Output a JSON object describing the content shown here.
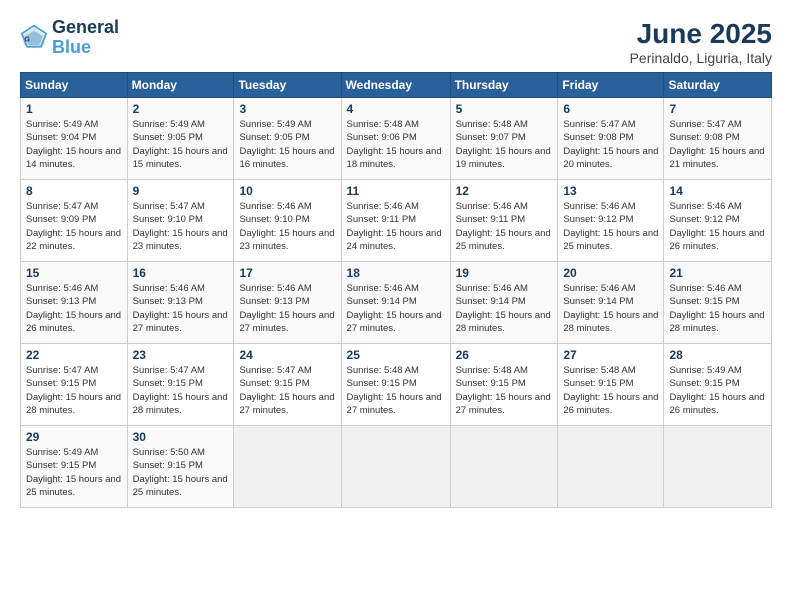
{
  "logo": {
    "line1": "General",
    "line2": "Blue"
  },
  "title": "June 2025",
  "location": "Perinaldo, Liguria, Italy",
  "weekdays": [
    "Sunday",
    "Monday",
    "Tuesday",
    "Wednesday",
    "Thursday",
    "Friday",
    "Saturday"
  ],
  "weeks": [
    [
      {
        "day": 1,
        "sunrise": "5:49 AM",
        "sunset": "9:04 PM",
        "daylight": "15 hours and 14 minutes."
      },
      {
        "day": 2,
        "sunrise": "5:49 AM",
        "sunset": "9:05 PM",
        "daylight": "15 hours and 15 minutes."
      },
      {
        "day": 3,
        "sunrise": "5:49 AM",
        "sunset": "9:05 PM",
        "daylight": "15 hours and 16 minutes."
      },
      {
        "day": 4,
        "sunrise": "5:48 AM",
        "sunset": "9:06 PM",
        "daylight": "15 hours and 18 minutes."
      },
      {
        "day": 5,
        "sunrise": "5:48 AM",
        "sunset": "9:07 PM",
        "daylight": "15 hours and 19 minutes."
      },
      {
        "day": 6,
        "sunrise": "5:47 AM",
        "sunset": "9:08 PM",
        "daylight": "15 hours and 20 minutes."
      },
      {
        "day": 7,
        "sunrise": "5:47 AM",
        "sunset": "9:08 PM",
        "daylight": "15 hours and 21 minutes."
      }
    ],
    [
      {
        "day": 8,
        "sunrise": "5:47 AM",
        "sunset": "9:09 PM",
        "daylight": "15 hours and 22 minutes."
      },
      {
        "day": 9,
        "sunrise": "5:47 AM",
        "sunset": "9:10 PM",
        "daylight": "15 hours and 23 minutes."
      },
      {
        "day": 10,
        "sunrise": "5:46 AM",
        "sunset": "9:10 PM",
        "daylight": "15 hours and 23 minutes."
      },
      {
        "day": 11,
        "sunrise": "5:46 AM",
        "sunset": "9:11 PM",
        "daylight": "15 hours and 24 minutes."
      },
      {
        "day": 12,
        "sunrise": "5:46 AM",
        "sunset": "9:11 PM",
        "daylight": "15 hours and 25 minutes."
      },
      {
        "day": 13,
        "sunrise": "5:46 AM",
        "sunset": "9:12 PM",
        "daylight": "15 hours and 25 minutes."
      },
      {
        "day": 14,
        "sunrise": "5:46 AM",
        "sunset": "9:12 PM",
        "daylight": "15 hours and 26 minutes."
      }
    ],
    [
      {
        "day": 15,
        "sunrise": "5:46 AM",
        "sunset": "9:13 PM",
        "daylight": "15 hours and 26 minutes."
      },
      {
        "day": 16,
        "sunrise": "5:46 AM",
        "sunset": "9:13 PM",
        "daylight": "15 hours and 27 minutes."
      },
      {
        "day": 17,
        "sunrise": "5:46 AM",
        "sunset": "9:13 PM",
        "daylight": "15 hours and 27 minutes."
      },
      {
        "day": 18,
        "sunrise": "5:46 AM",
        "sunset": "9:14 PM",
        "daylight": "15 hours and 27 minutes."
      },
      {
        "day": 19,
        "sunrise": "5:46 AM",
        "sunset": "9:14 PM",
        "daylight": "15 hours and 28 minutes."
      },
      {
        "day": 20,
        "sunrise": "5:46 AM",
        "sunset": "9:14 PM",
        "daylight": "15 hours and 28 minutes."
      },
      {
        "day": 21,
        "sunrise": "5:46 AM",
        "sunset": "9:15 PM",
        "daylight": "15 hours and 28 minutes."
      }
    ],
    [
      {
        "day": 22,
        "sunrise": "5:47 AM",
        "sunset": "9:15 PM",
        "daylight": "15 hours and 28 minutes."
      },
      {
        "day": 23,
        "sunrise": "5:47 AM",
        "sunset": "9:15 PM",
        "daylight": "15 hours and 28 minutes."
      },
      {
        "day": 24,
        "sunrise": "5:47 AM",
        "sunset": "9:15 PM",
        "daylight": "15 hours and 27 minutes."
      },
      {
        "day": 25,
        "sunrise": "5:48 AM",
        "sunset": "9:15 PM",
        "daylight": "15 hours and 27 minutes."
      },
      {
        "day": 26,
        "sunrise": "5:48 AM",
        "sunset": "9:15 PM",
        "daylight": "15 hours and 27 minutes."
      },
      {
        "day": 27,
        "sunrise": "5:48 AM",
        "sunset": "9:15 PM",
        "daylight": "15 hours and 26 minutes."
      },
      {
        "day": 28,
        "sunrise": "5:49 AM",
        "sunset": "9:15 PM",
        "daylight": "15 hours and 26 minutes."
      }
    ],
    [
      {
        "day": 29,
        "sunrise": "5:49 AM",
        "sunset": "9:15 PM",
        "daylight": "15 hours and 25 minutes."
      },
      {
        "day": 30,
        "sunrise": "5:50 AM",
        "sunset": "9:15 PM",
        "daylight": "15 hours and 25 minutes."
      },
      null,
      null,
      null,
      null,
      null
    ]
  ]
}
